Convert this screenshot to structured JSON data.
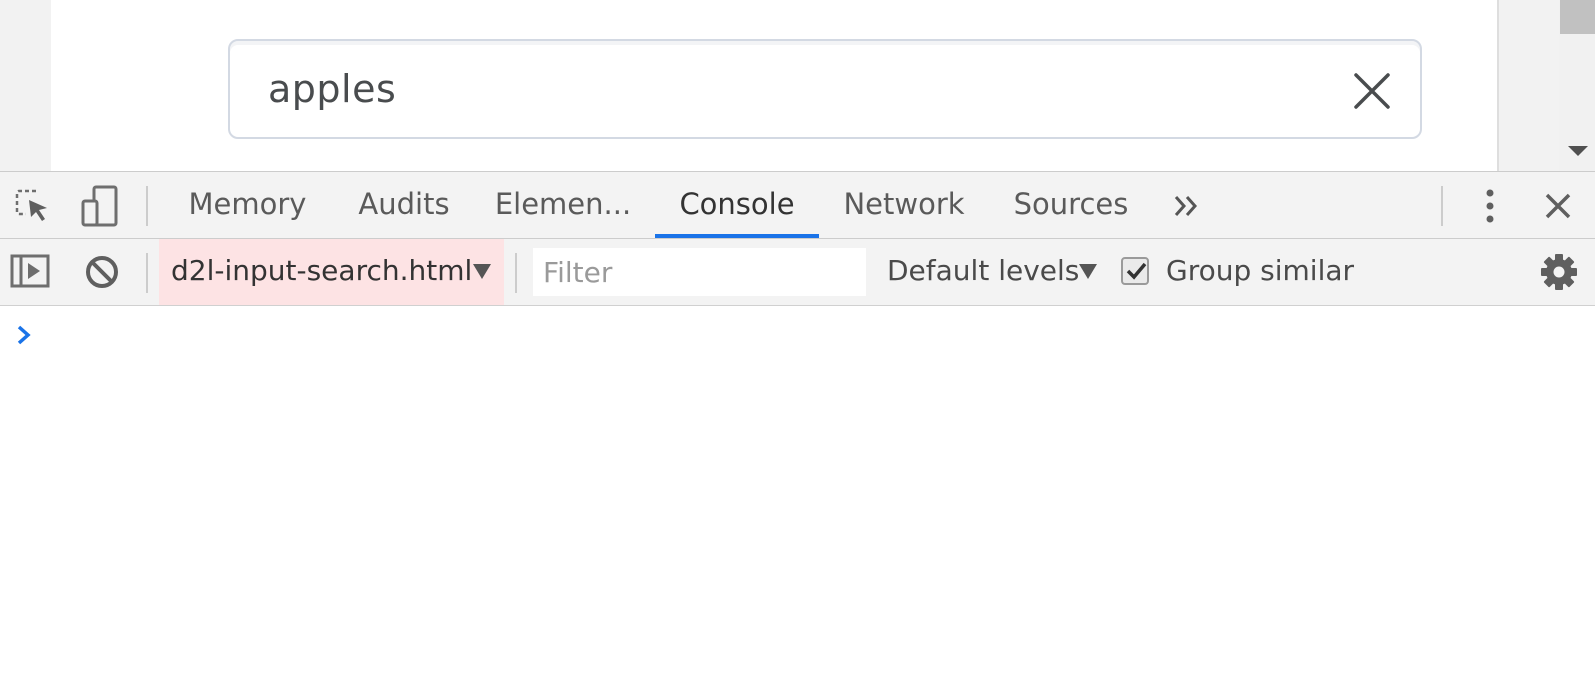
{
  "page": {
    "search": {
      "value": "apples"
    }
  },
  "devtools": {
    "tabs": [
      {
        "label": "Memory"
      },
      {
        "label": "Audits"
      },
      {
        "label": "Elemen..."
      },
      {
        "label": "Console",
        "active": true
      },
      {
        "label": "Network"
      },
      {
        "label": "Sources"
      }
    ],
    "more_tabs_icon": "double-chevron-right-icon",
    "active_tab_color": "#1a73e8",
    "console": {
      "context": "d2l-input-search.html",
      "filter_placeholder": "Filter",
      "filter_value": "",
      "levels": "Default levels",
      "group_similar": {
        "label": "Group similar",
        "checked": true
      },
      "context_highlight_color": "#fde3e4",
      "prompt_color": "#1a73e8"
    }
  }
}
